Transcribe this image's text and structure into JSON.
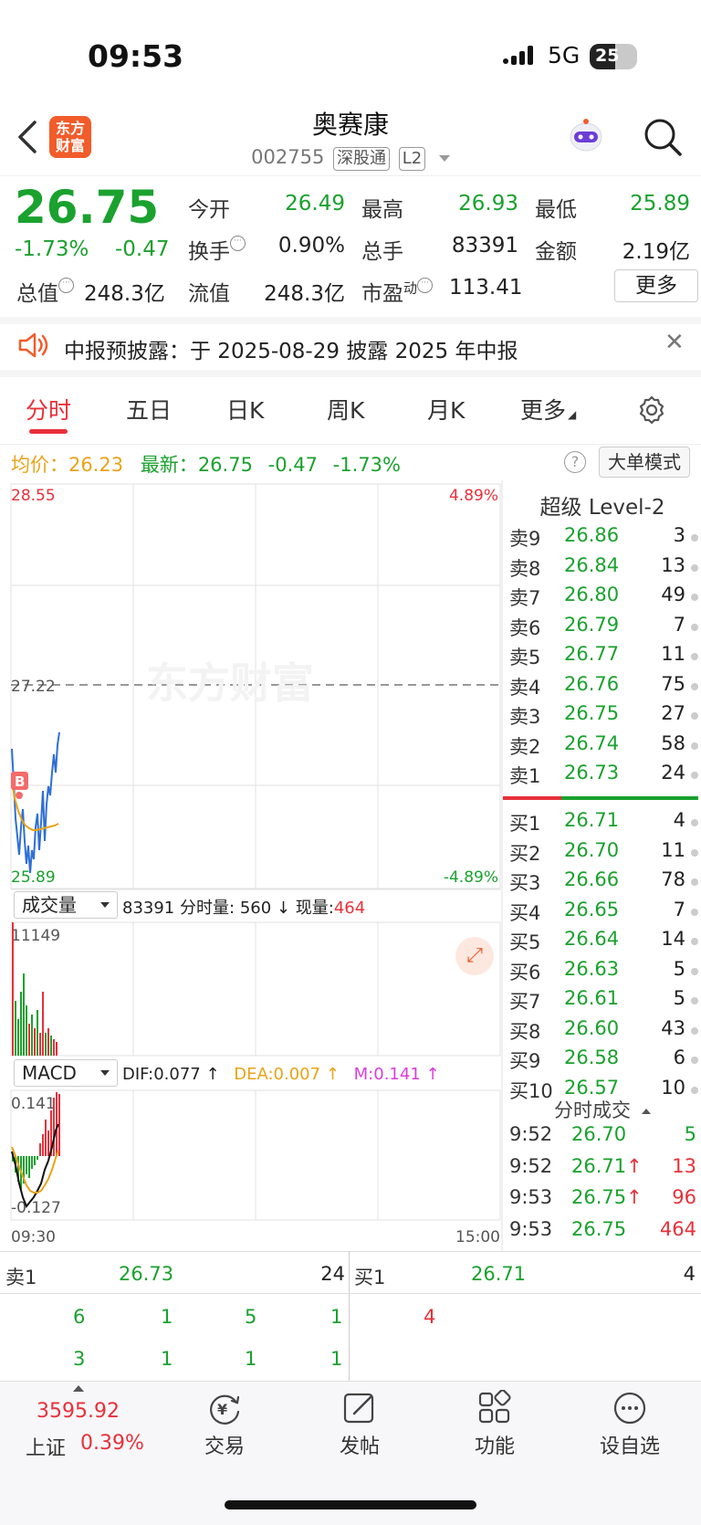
{
  "status_bar": {
    "time": "09:53",
    "network": "5G",
    "battery": "25"
  },
  "header": {
    "logo_text_line1": "东方",
    "logo_text_line2": "财富",
    "stock_name": "奥赛康",
    "stock_code": "002755",
    "tag_connect": "深股通",
    "tag_level": "L2"
  },
  "quote": {
    "price": "26.75",
    "change_pct": "-1.73%",
    "change": "-0.47",
    "open_label": "今开",
    "open": "26.49",
    "high_label": "最高",
    "high": "26.93",
    "low_label": "最低",
    "low": "25.89",
    "turnover_label": "换手",
    "turnover": "0.90%",
    "volume_label": "总手",
    "volume": "83391",
    "amount_label": "金额",
    "amount": "2.19亿",
    "mktcap_label": "总值",
    "mktcap": "248.3亿",
    "float_label": "流值",
    "float_cap": "248.3亿",
    "pe_label": "市盈",
    "pe_sup": "动",
    "pe": "113.41",
    "more_label": "更多"
  },
  "notice": {
    "text": "中报预披露：于 2025-08-29 披露 2025 年中报"
  },
  "tabs": [
    "分时",
    "五日",
    "日K",
    "周K",
    "月K",
    "更多"
  ],
  "info_row": {
    "avg_label": "均价：",
    "avg": "26.23",
    "latest_label": "最新：",
    "latest": "26.75",
    "latest_chg": "-0.47",
    "latest_pct": "-1.73%",
    "help": "?",
    "big_order_mode": "大单模式"
  },
  "intraday": {
    "y_top": "28.55",
    "y_mid": "27.22",
    "y_bottom": "25.89",
    "pct_top": "4.89%",
    "pct_bottom": "-4.89%",
    "marker": "B",
    "watermark": "东方财富"
  },
  "volume_panel": {
    "selector": "成交量",
    "total": "83391",
    "min_vol_label": "分时量:",
    "min_vol": "560",
    "arrow": "↓",
    "cur_vol_label": "现量:",
    "cur_vol": "464",
    "y_max": "11149"
  },
  "macd_panel": {
    "selector": "MACD",
    "dif": "DIF:0.077 ↑",
    "dea": "DEA:0.007 ↑",
    "m": "M:0.141 ↑",
    "y_top": "0.141",
    "y_bottom": "-0.127",
    "time_start": "09:30",
    "time_end": "15:00"
  },
  "level2": {
    "title": "超级 Level-2",
    "asks": [
      {
        "label": "卖9",
        "price": "26.86",
        "vol": "3"
      },
      {
        "label": "卖8",
        "price": "26.84",
        "vol": "13"
      },
      {
        "label": "卖7",
        "price": "26.80",
        "vol": "49"
      },
      {
        "label": "卖6",
        "price": "26.79",
        "vol": "7"
      },
      {
        "label": "卖5",
        "price": "26.77",
        "vol": "11"
      },
      {
        "label": "卖4",
        "price": "26.76",
        "vol": "75"
      },
      {
        "label": "卖3",
        "price": "26.75",
        "vol": "27"
      },
      {
        "label": "卖2",
        "price": "26.74",
        "vol": "58"
      },
      {
        "label": "卖1",
        "price": "26.73",
        "vol": "24"
      }
    ],
    "bids": [
      {
        "label": "买1",
        "price": "26.71",
        "vol": "4"
      },
      {
        "label": "买2",
        "price": "26.70",
        "vol": "11"
      },
      {
        "label": "买3",
        "price": "26.66",
        "vol": "78"
      },
      {
        "label": "买4",
        "price": "26.65",
        "vol": "7"
      },
      {
        "label": "买5",
        "price": "26.64",
        "vol": "14"
      },
      {
        "label": "买6",
        "price": "26.63",
        "vol": "5"
      },
      {
        "label": "买7",
        "price": "26.61",
        "vol": "5"
      },
      {
        "label": "买8",
        "price": "26.60",
        "vol": "43"
      },
      {
        "label": "买9",
        "price": "26.58",
        "vol": "6"
      },
      {
        "label": "买10",
        "price": "26.57",
        "vol": "10"
      }
    ],
    "trades_title": "分时成交",
    "trades": [
      {
        "time": "9:52",
        "price": "26.70",
        "vol": "5",
        "dir": "",
        "color": "#1aa12e"
      },
      {
        "time": "9:52",
        "price": "26.71",
        "vol": "13",
        "dir": "↑",
        "color": "#e8303a"
      },
      {
        "time": "9:53",
        "price": "26.75",
        "vol": "96",
        "dir": "↑",
        "color": "#e8303a"
      },
      {
        "time": "9:53",
        "price": "26.75",
        "vol": "464",
        "dir": "",
        "color": "#e8303a"
      }
    ]
  },
  "order_queue": {
    "ask_label": "卖1",
    "ask_price": "26.73",
    "ask_vol": "24",
    "bid_label": "买1",
    "bid_price": "26.71",
    "bid_vol": "4",
    "ask_row1": [
      "6",
      "1",
      "5",
      "1"
    ],
    "ask_row2": [
      "3",
      "1",
      "1",
      "1"
    ],
    "bid_row1": [
      "4"
    ]
  },
  "bottom_nav": {
    "index_value": "3595.92",
    "index_name": "上证",
    "index_pct": "0.39%",
    "items": [
      "交易",
      "发帖",
      "功能",
      "设自选"
    ]
  },
  "colors": {
    "up": "#e8303a",
    "down": "#1aa12e",
    "avg_line": "#e8a317",
    "price_line": "#2f6fd6",
    "brand": "#f25c2a"
  }
}
